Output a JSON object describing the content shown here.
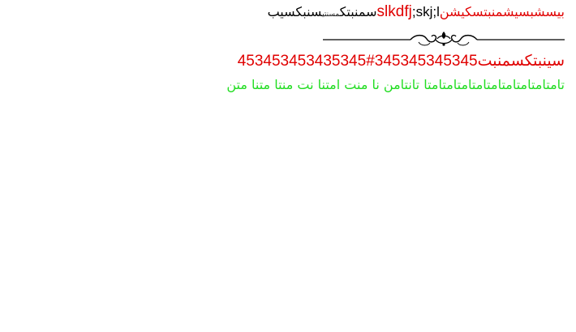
{
  "line1": {
    "part1": "بیسشبسیشمنبتسکیشن",
    "part2": "slkdfj",
    "part3": ";skj;l",
    "part4": "سمنبتک",
    "part5": "مسنتی",
    "part6": "سنبکسیب"
  },
  "divider_icon": "ornamental-flourish",
  "line3": {
    "text": "سینبتکسمنبت",
    "number": "345345345345#453453453435345"
  },
  "line4": {
    "text": "تامتامتامتامتامتامتامتامتامتا تانتامن  نا منت امتنا نت منتا متنا متن"
  },
  "colors": {
    "red": "#e00000",
    "green": "#22dd22",
    "black": "#000000"
  }
}
